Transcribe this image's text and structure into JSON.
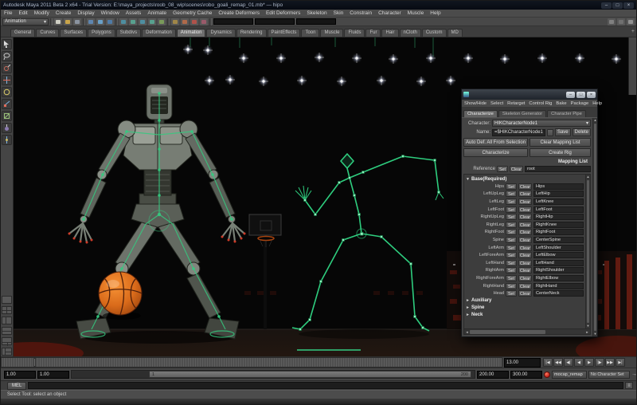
{
  "titlebar": {
    "title": "Autodesk Maya 2011 Beta 2 x64 - Trial Version: E:\\maya_projects\\roob_08_wip\\scenes\\robo_goali_remap_01.mb*  —  hipo",
    "minimize": "–",
    "maximize": "□",
    "close": "×"
  },
  "menubar": {
    "items": [
      "File",
      "Edit",
      "Modify",
      "Create",
      "Display",
      "Window",
      "Assets",
      "Animate",
      "Geometry Cache",
      "Create Deformers",
      "Edit Deformers",
      "Skeleton",
      "Skin",
      "Constrain",
      "Character",
      "Muscle",
      "Help"
    ]
  },
  "statusline": {
    "menuset": "Animation",
    "menuset_arrow": "▾"
  },
  "shelf": {
    "tabs": [
      "General",
      "Curves",
      "Surfaces",
      "Polygons",
      "Subdivs",
      "Deformation",
      "Animation",
      "Dynamics",
      "Rendering",
      "PaintEffects",
      "Toon",
      "Muscle",
      "Fluids",
      "Fur",
      "Hair",
      "nCloth",
      "Custom",
      "MD"
    ],
    "active_tab": "Animation",
    "overflow_glyph": "+"
  },
  "hik": {
    "window_buttons": {
      "minimize": "–",
      "maximize": "□",
      "close": "×"
    },
    "menus": [
      "Show/Hide",
      "Select",
      "Retarget",
      "Control Rig",
      "Bake",
      "Package",
      "Help"
    ],
    "tabs": [
      "Characterize",
      "Skeleton Generator",
      "Character Pipe"
    ],
    "character_label": "Character:",
    "character_value": "HIKCharacterNode1",
    "dropdown_arrow": "▾",
    "name_label": "Name:",
    "name_value": "=$HIKCharacterNode1",
    "save_button": "Save",
    "delete_button": "Delete",
    "auto_button": "Auto Def. All From Selection",
    "clear_mapping_button": "Clear Mapping List",
    "characterize_button": "Characterize",
    "create_rig_button": "Create Rig",
    "mapping_list_label": "Mapping List",
    "reference_label": "Reference",
    "reference_value": "root",
    "set_label": "Set",
    "clear_label": "Clear",
    "expanded_arrow": "▼",
    "collapsed_arrow": "►",
    "base_section_label": "Base(Required)",
    "rows": [
      {
        "slot": "Hips",
        "value": "Hips"
      },
      {
        "slot": "LeftUpLeg",
        "value": "LeftHip"
      },
      {
        "slot": "LeftLeg",
        "value": "LeftKnee"
      },
      {
        "slot": "LeftFoot",
        "value": "LeftFoot"
      },
      {
        "slot": "RightUpLeg",
        "value": "RightHip"
      },
      {
        "slot": "RightLeg",
        "value": "RightKnee"
      },
      {
        "slot": "RightFoot",
        "value": "RightFoot"
      },
      {
        "slot": "Spine",
        "value": "CenterSpine"
      },
      {
        "slot": "LeftArm",
        "value": "LeftShoulder"
      },
      {
        "slot": "LeftForeArm",
        "value": "LeftElbow"
      },
      {
        "slot": "LeftHand",
        "value": "LeftHand"
      },
      {
        "slot": "RightArm",
        "value": "RightShoulder"
      },
      {
        "slot": "RightForeArm",
        "value": "RightElbow"
      },
      {
        "slot": "RightHand",
        "value": "RightHand"
      },
      {
        "slot": "Head",
        "value": "CenterNeck"
      }
    ],
    "collapsed_sections": [
      "Auxiliary",
      "Spine",
      "Neck"
    ],
    "scroll_up": "▲",
    "scroll_down": "▼",
    "scroll_left": "◄",
    "scroll_right": "►"
  },
  "timeslider": {
    "current_time": "13.00",
    "transport": [
      "|◀",
      "◀◀",
      "◀|",
      "◀",
      "▶",
      "|▶",
      "▶▶",
      "▶|"
    ]
  },
  "rangeslider": {
    "anim_start": "1.00",
    "playback_start": "1.00",
    "range_bar_start": "1",
    "range_bar_end": "200",
    "playback_end": "200.00",
    "anim_end": "300.00",
    "clip_menu": "mocap_remap",
    "character_set_menu": "No Character Set",
    "arrow": "→"
  },
  "commandline": {
    "mel_label": "MEL"
  },
  "helpline": {
    "text": "Select Tool: select an object"
  },
  "colors": {
    "rig_green": "#2ecd7e",
    "ball_orange": "#e07a20",
    "seat_red": "#5a170f",
    "ui_gray": "#4b4b4b",
    "viewport_bg": "#060606"
  }
}
